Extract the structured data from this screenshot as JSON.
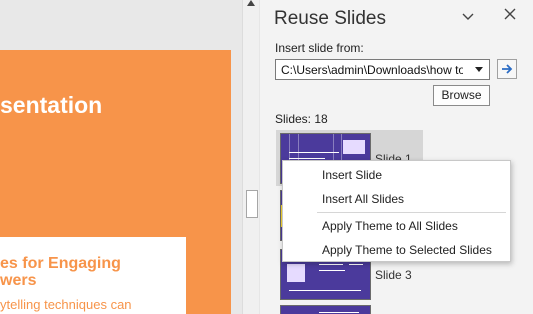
{
  "slide": {
    "title": "sentation",
    "box_title_line1": "es for Engaging",
    "box_title_line2": "wers",
    "box_body": "ytelling techniques can"
  },
  "pane": {
    "title": "Reuse Slides",
    "insert_from_label": "Insert slide from:",
    "path_value": "C:\\Users\\admin\\Downloads\\how to",
    "browse_label": "Browse",
    "slides_count": "Slides: 18",
    "thumbnails": [
      {
        "label": "Slide 1"
      },
      {
        "label": ""
      },
      {
        "label": "Slide 3"
      },
      {
        "label": ""
      }
    ]
  },
  "context_menu": {
    "items": [
      {
        "label": "Insert Slide"
      },
      {
        "label": "Insert All Slides"
      },
      {
        "label": "Apply Theme to All Slides"
      },
      {
        "label": "Apply Theme to Selected Slides"
      }
    ]
  },
  "colors": {
    "slide_orange": "#f7944a",
    "thumb_purple": "#4b3a9c",
    "accent_blue": "#2b6cc4"
  }
}
